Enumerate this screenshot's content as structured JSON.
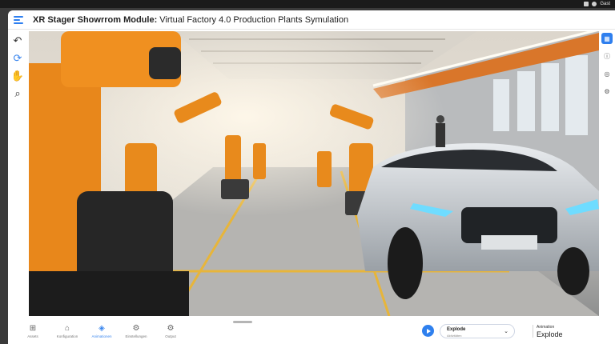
{
  "os_bar": {
    "user": "Gast"
  },
  "window": {
    "title_bold": "XR Stager Showrrom Module:",
    "title_rest": " Virtual Factory 4.0 Production Plants Symulation"
  },
  "left_tools": [
    {
      "name": "back-icon",
      "glyph": "↶"
    },
    {
      "name": "orbit-icon",
      "glyph": "⟳"
    },
    {
      "name": "hand-icon",
      "glyph": "✋"
    },
    {
      "name": "search-icon",
      "glyph": "⌕"
    }
  ],
  "right_tools": [
    {
      "name": "layers-icon",
      "glyph": "▦"
    },
    {
      "name": "info-icon",
      "glyph": "ⓘ"
    },
    {
      "name": "vr-icon",
      "glyph": "◎"
    },
    {
      "name": "settings-icon",
      "glyph": "⚙"
    }
  ],
  "bottom_nav": {
    "tabs": [
      {
        "label": "Assets",
        "glyph": "⊞"
      },
      {
        "label": "Konfiguration",
        "glyph": "⌂"
      },
      {
        "label": "Animationen",
        "glyph": "◈"
      },
      {
        "label": "Einstellungen",
        "glyph": "⚙"
      },
      {
        "label": "Output",
        "glyph": "⚙"
      }
    ],
    "active_tab": "Animationen"
  },
  "animation": {
    "select_value": "Explode",
    "select_sublabel": "Aktivitäten",
    "info_label": "Animation",
    "info_value": "Explode"
  },
  "colors": {
    "accent": "#2f80ee"
  }
}
